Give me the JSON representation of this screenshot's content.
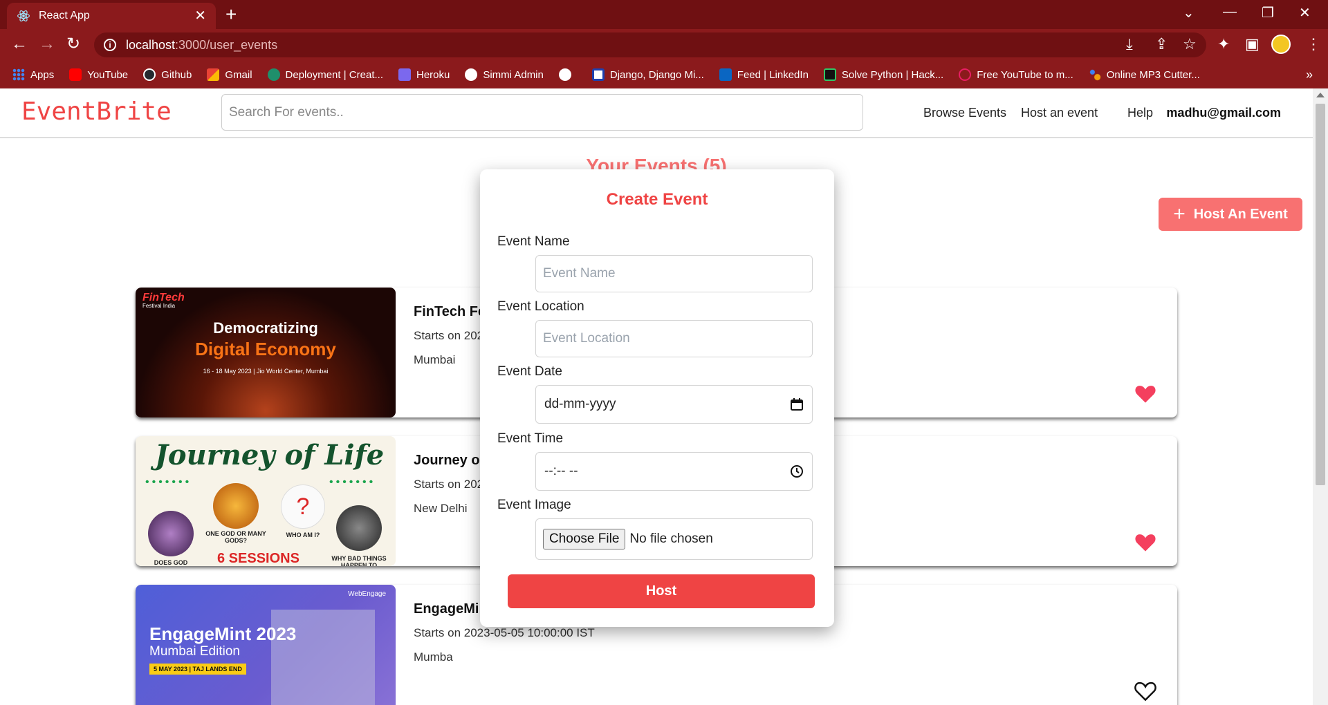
{
  "browser": {
    "tab_title": "React App",
    "url_host": "localhost",
    "url_path": ":3000/user_events",
    "bookmarks": [
      {
        "label": "Apps",
        "color": "#4285f4"
      },
      {
        "label": "YouTube",
        "color": "#ff0000"
      },
      {
        "label": "Github",
        "color": "#24292f"
      },
      {
        "label": "Gmail",
        "color": "#ea4335"
      },
      {
        "label": "Deployment | Creat...",
        "color": "#1f8f6b"
      },
      {
        "label": "Heroku",
        "color": "#7b68ee"
      },
      {
        "label": "Simmi Admin",
        "color": "#ffffff"
      },
      {
        "label": "",
        "color": "#ffffff"
      },
      {
        "label": "Django, Django Mi...",
        "color": "#1e40af"
      },
      {
        "label": "Feed | LinkedIn",
        "color": "#0a66c2"
      },
      {
        "label": "Solve Python | Hack...",
        "color": "#111111"
      },
      {
        "label": "Free YouTube to m...",
        "color": "#e91e63"
      },
      {
        "label": "Online MP3 Cutter...",
        "color": "#f59e0b"
      }
    ],
    "bookmarks_more": "»"
  },
  "header": {
    "logo": "EventBrite",
    "search_placeholder": "Search For events..",
    "nav": [
      "Browse Events",
      "Host an event",
      "Help"
    ],
    "user_email": "madhu@gmail.com"
  },
  "page": {
    "heading": "Your Events (5)",
    "host_button_label": "Host An Event"
  },
  "events": [
    {
      "title": "FinTech Fe",
      "start": "Starts on 202",
      "location": "Mumbai",
      "liked": true,
      "image_text": {
        "brand": "FinTech",
        "brand_sub": "Festival India",
        "line1": "Democratizing",
        "line2": "Digital Economy",
        "line3": "16 - 18 May 2023 | Jio World Center, Mumbai"
      }
    },
    {
      "title": "Journey of",
      "start": "Starts on 202",
      "location": "New Delhi",
      "liked": true,
      "image_text": {
        "title": "Journey of Life",
        "cap1": "DOES GOD",
        "cap2": "ONE GOD OR MANY GODS?",
        "cap3": "WHO AM I?",
        "cap4": "WHY BAD THINGS HAPPEN TO",
        "sessions": "6 SESSIONS"
      }
    },
    {
      "title": "EngageMi",
      "start": "Starts on 2023-05-05 10:00:00 IST",
      "location": "Mumba",
      "liked": false,
      "image_text": {
        "brand": "WebEngage",
        "line1": "EngageMint 2023",
        "line2": "Mumbai Edition",
        "line3": "5 MAY 2023 | TAJ LANDS END"
      }
    }
  ],
  "modal": {
    "title": "Create Event",
    "fields": {
      "name_label": "Event Name",
      "name_placeholder": "Event Name",
      "location_label": "Event Location",
      "location_placeholder": "Event Location",
      "date_label": "Event Date",
      "date_value": "dd-mm-yyyy",
      "time_label": "Event Time",
      "time_value": "--:-- --",
      "image_label": "Event Image",
      "choose_file": "Choose File",
      "no_file": "No file chosen"
    },
    "submit_label": "Host"
  },
  "colors": {
    "brand": "#ef4444",
    "accent_light": "#f87171",
    "heart_liked": "#f43f5e",
    "chrome": "#8b1a1c"
  }
}
